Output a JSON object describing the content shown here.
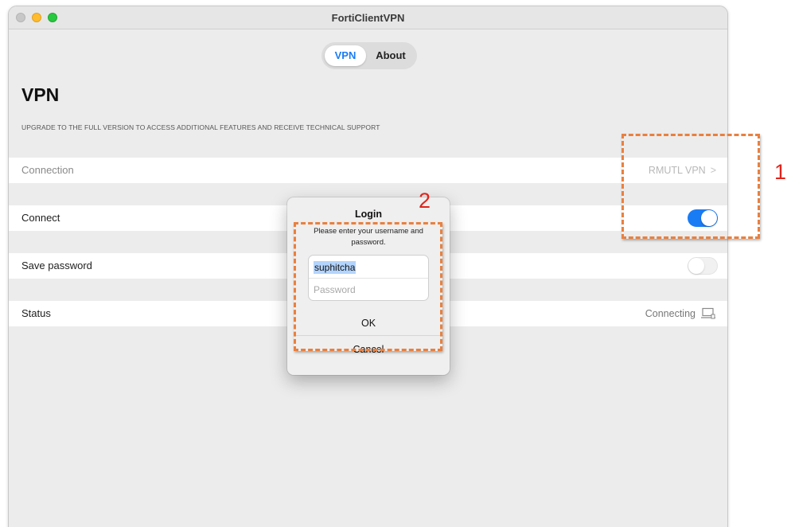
{
  "window": {
    "title": "FortiClientVPN"
  },
  "tabs": [
    {
      "label": "VPN",
      "active": true
    },
    {
      "label": "About",
      "active": false
    }
  ],
  "page": {
    "title": "VPN",
    "notice": "UPGRADE TO THE FULL VERSION TO ACCESS ADDITIONAL FEATURES AND RECEIVE TECHNICAL SUPPORT"
  },
  "rows": {
    "connection": {
      "label": "Connection",
      "value": "RMUTL VPN",
      "chevron": ">"
    },
    "connect": {
      "label": "Connect",
      "toggle_on": true
    },
    "save_password": {
      "label": "Save password",
      "toggle_on": false
    },
    "status": {
      "label": "Status",
      "value": "Connecting",
      "icon": "computer-icon"
    }
  },
  "login_dialog": {
    "title": "Login",
    "message": "Please enter your username and password.",
    "username_value": "suphitcha",
    "password_placeholder": "Password",
    "ok_label": "OK",
    "cancel_label": "Cancel"
  },
  "annotations": [
    {
      "label": "1",
      "color": "#e0241b",
      "border_color": "#e9803f"
    },
    {
      "label": "2",
      "color": "#e0241b",
      "border_color": "#e9803f"
    }
  ],
  "colors": {
    "accent": "#1a7cf5",
    "traffic_min": "#febc2e",
    "traffic_max": "#28c840"
  }
}
